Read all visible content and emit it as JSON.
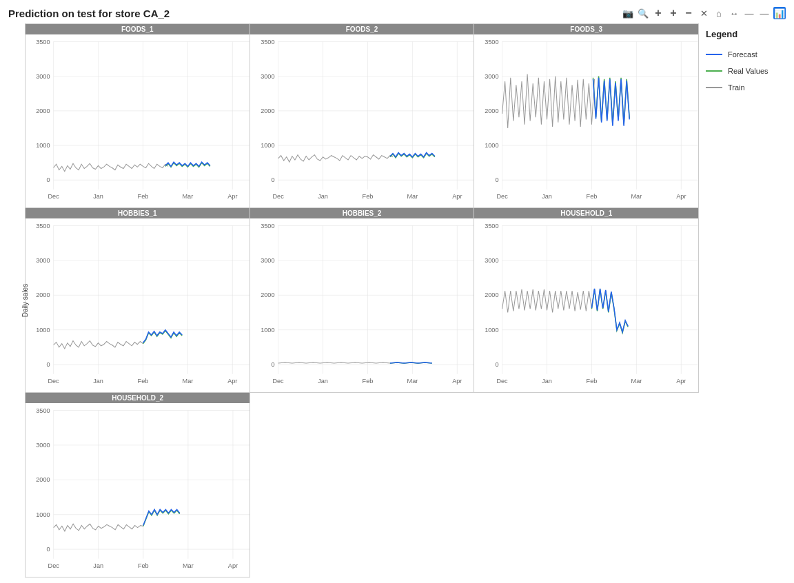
{
  "title": "Prediction on test  for store CA_2",
  "toolbar": {
    "icons": [
      "📷",
      "🔍",
      "+",
      "+",
      "-",
      "✕",
      "⌂",
      "↔",
      "—",
      "—",
      "📊"
    ]
  },
  "legend": {
    "title": "Legend",
    "items": [
      {
        "label": "Forecast",
        "color": "#2563eb"
      },
      {
        "label": "Real Values",
        "color": "#4caf50"
      },
      {
        "label": "Train",
        "color": "#999"
      }
    ]
  },
  "y_axis_label": "Daily sales",
  "charts": [
    {
      "id": "foods1",
      "title": "FOODS_1",
      "row": 0,
      "col": 0
    },
    {
      "id": "foods2",
      "title": "FOODS_2",
      "row": 0,
      "col": 1
    },
    {
      "id": "foods3",
      "title": "FOODS_3",
      "row": 0,
      "col": 2
    },
    {
      "id": "hobbies1",
      "title": "HOBBIES_1",
      "row": 1,
      "col": 0
    },
    {
      "id": "hobbies2",
      "title": "HOBBIES_2",
      "row": 1,
      "col": 1
    },
    {
      "id": "household1",
      "title": "HOUSEHOLD_1",
      "row": 1,
      "col": 2
    },
    {
      "id": "household2",
      "title": "HOUSEHOLD_2",
      "row": 2,
      "col": 0
    }
  ],
  "x_axis_months": [
    "Dec",
    "Jan",
    "Feb",
    "Mar",
    "Apr"
  ],
  "y_ticks": {
    "high": [
      "3500",
      "3000",
      "2000",
      "1000",
      "0"
    ],
    "low": [
      "3500",
      "3000",
      "2000",
      "1000",
      "0"
    ]
  }
}
